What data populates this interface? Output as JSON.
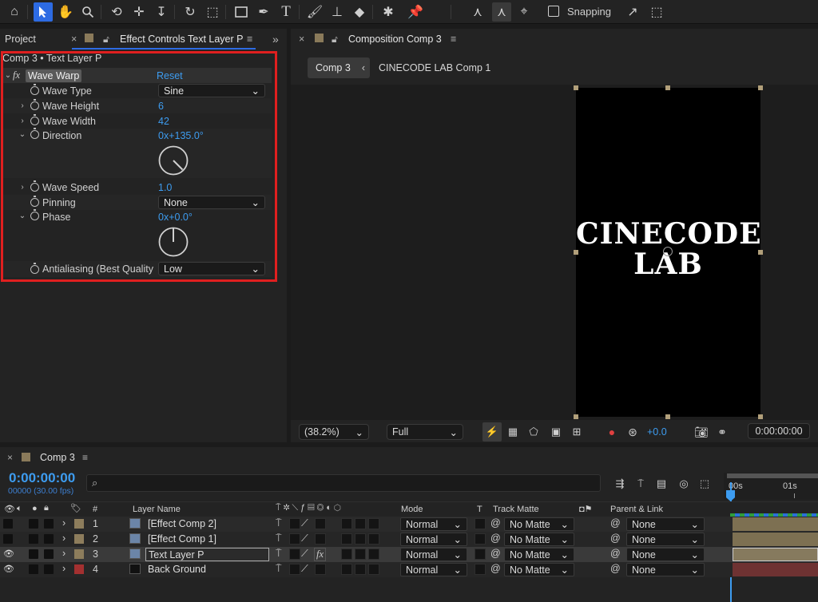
{
  "toolbar": {
    "snapping_label": "Snapping"
  },
  "effect_panel": {
    "project_tab": "Project",
    "tab_title": "Effect Controls Text Layer P",
    "breadcrumb": "Comp 3 • Text Layer P",
    "effect_name": "Wave Warp",
    "reset_label": "Reset",
    "props": {
      "wave_type": {
        "label": "Wave Type",
        "value": "Sine"
      },
      "wave_height": {
        "label": "Wave Height",
        "value": "6"
      },
      "wave_width": {
        "label": "Wave Width",
        "value": "42"
      },
      "direction": {
        "label": "Direction",
        "value": "0x+135.0°"
      },
      "wave_speed": {
        "label": "Wave Speed",
        "value": "1.0"
      },
      "pinning": {
        "label": "Pinning",
        "value": "None"
      },
      "phase": {
        "label": "Phase",
        "value": "0x+0.0°"
      },
      "antialiasing": {
        "label": "Antialiasing (Best Quality",
        "value": "Low"
      }
    }
  },
  "comp_panel": {
    "tab_title": "Composition Comp 3",
    "crumb_active": "Comp 3",
    "crumb_next": "CINECODE LAB Comp 1",
    "canvas_text_line1": "CINECODE",
    "canvas_text_line2": "LAB",
    "zoom": "(38.2%)",
    "resolution": "Full",
    "exposure": "+0.0",
    "timecode": "0:00:00:00"
  },
  "timeline": {
    "tab": "Comp 3",
    "timecode": "0:00:00:00",
    "frames": "00000 (30.00 fps)",
    "search_placeholder": "",
    "ruler": [
      "00s",
      "01s"
    ],
    "headers": {
      "num": "#",
      "layer_name": "Layer Name",
      "mode": "Mode",
      "t": "T",
      "track_matte": "Track Matte",
      "parent": "Parent & Link"
    },
    "layers": [
      {
        "num": "1",
        "name": "[Effect Comp 2]",
        "mode": "Normal",
        "matte": "No Matte",
        "parent": "None",
        "label": "#8d7d5c",
        "bar": "#7d7052"
      },
      {
        "num": "2",
        "name": "[Effect Comp 1]",
        "mode": "Normal",
        "matte": "No Matte",
        "parent": "None",
        "label": "#8d7d5c",
        "bar": "#7d7052"
      },
      {
        "num": "3",
        "name": "Text Layer P",
        "mode": "Normal",
        "matte": "No Matte",
        "parent": "None",
        "label": "#8d7d5c",
        "bar": "#867a5e"
      },
      {
        "num": "4",
        "name": "Back Ground",
        "mode": "Normal",
        "matte": "No Matte",
        "parent": "None",
        "label": "#a33030",
        "bar": "#6e3232"
      }
    ]
  },
  "colors": {
    "accent": "#2d6be3",
    "highlight": "#e01f1f",
    "timecode": "#3d9cf0"
  }
}
